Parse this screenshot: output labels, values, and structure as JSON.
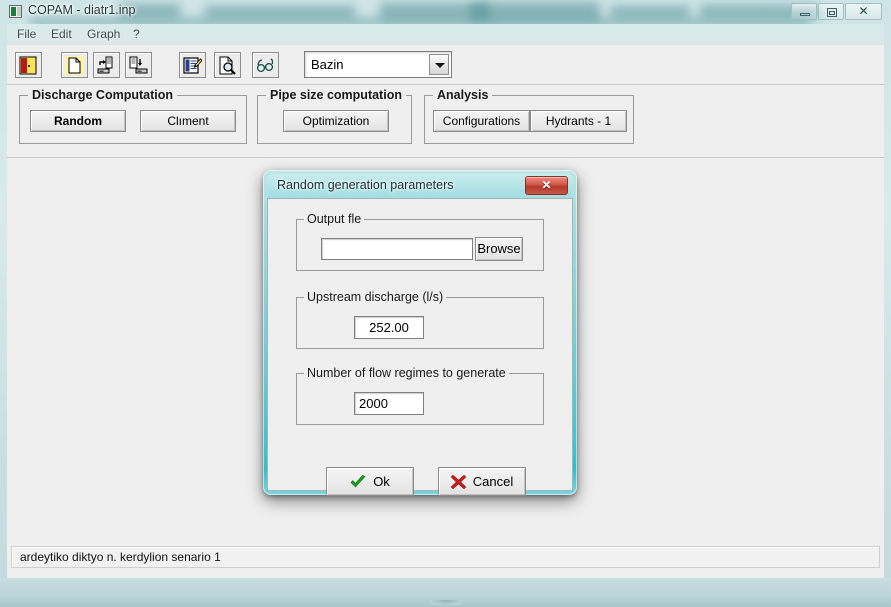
{
  "window": {
    "title": "COPAM - diatr1.inp",
    "app_icon": "app-icon",
    "controls": {
      "minimize": "minimize-icon",
      "maximize": "maximize-icon",
      "close": "✕"
    }
  },
  "menubar": {
    "items": [
      {
        "label": "File"
      },
      {
        "label": "Edit"
      },
      {
        "label": "Graph"
      },
      {
        "label": "?"
      }
    ]
  },
  "toolbar": {
    "buttons": [
      {
        "name": "exit-door-icon",
        "tooltip": "Exit"
      },
      {
        "name": "new-file-icon",
        "tooltip": "New"
      },
      {
        "name": "open-file-icon",
        "tooltip": "Open"
      },
      {
        "name": "save-file-icon",
        "tooltip": "Save"
      },
      {
        "name": "edit-data-icon",
        "tooltip": "Edit data"
      },
      {
        "name": "preview-icon",
        "tooltip": "Preview"
      },
      {
        "name": "glasses-icon",
        "tooltip": "View"
      }
    ],
    "model_combo": {
      "value": "Bazin",
      "arrow": "chevron-down-icon"
    }
  },
  "panels": {
    "discharge": {
      "title": "Discharge Computation",
      "random_label": "Random",
      "climent_label": "Clıment"
    },
    "pipe": {
      "title": "Pipe size computation",
      "optimization_label": "Optimization"
    },
    "analysis": {
      "title": "Analysis",
      "configurations_label": "Configurations",
      "hydrants_label": "Hydrants - 1"
    }
  },
  "statusbar": {
    "text": "ardeytiko diktyo n. kerdylion senario 1"
  },
  "dialog": {
    "title": "Random generation parameters",
    "close_label": "✕",
    "output_group": {
      "title": "Output fle",
      "input_value": "",
      "input_placeholder": "",
      "browse_label": "Browse"
    },
    "upstream_group": {
      "title": "Upstream discharge (l/s)",
      "value": "252.00"
    },
    "regimes_group": {
      "title": "Number of flow regimes to generate",
      "value": "2000"
    },
    "ok_label": "Ok",
    "cancel_label": "Cancel"
  },
  "colors": {
    "glass_teal": "#79ced4",
    "glass_teal_bright": "#2ec0ca",
    "client_bg": "#efefef",
    "close_red": "#b33a2c",
    "ok_green": "#19a319",
    "cancel_red": "#c11f1f",
    "title_text": "#23383d"
  }
}
